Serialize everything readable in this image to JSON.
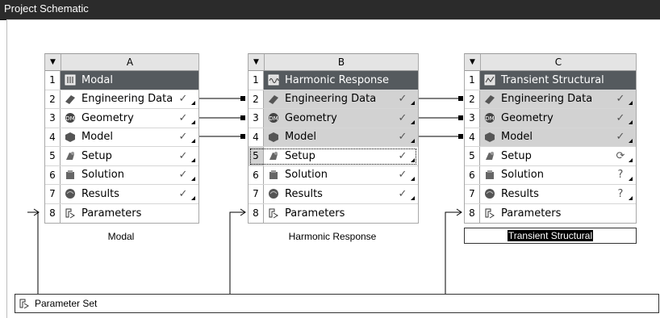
{
  "panel": {
    "title": "Project Schematic"
  },
  "systems": [
    {
      "letter": "A",
      "caption": "Modal",
      "rows": [
        {
          "num": "1",
          "label": "Modal",
          "status": "",
          "icon": "modal-icon"
        },
        {
          "num": "2",
          "label": "Engineering Data",
          "status": "✓",
          "icon": "engineering-data-icon"
        },
        {
          "num": "3",
          "label": "Geometry",
          "status": "✓",
          "icon": "geometry-icon"
        },
        {
          "num": "4",
          "label": "Model",
          "status": "✓",
          "icon": "model-icon"
        },
        {
          "num": "5",
          "label": "Setup",
          "status": "✓",
          "icon": "setup-icon"
        },
        {
          "num": "6",
          "label": "Solution",
          "status": "✓",
          "icon": "solution-icon"
        },
        {
          "num": "7",
          "label": "Results",
          "status": "✓",
          "icon": "results-icon"
        },
        {
          "num": "8",
          "label": "Parameters",
          "status": "",
          "icon": "parameters-icon"
        }
      ]
    },
    {
      "letter": "B",
      "caption": "Harmonic Response",
      "rows": [
        {
          "num": "1",
          "label": "Harmonic Response",
          "status": "",
          "icon": "harmonic-response-icon"
        },
        {
          "num": "2",
          "label": "Engineering Data",
          "status": "✓",
          "icon": "engineering-data-icon"
        },
        {
          "num": "3",
          "label": "Geometry",
          "status": "✓",
          "icon": "geometry-icon"
        },
        {
          "num": "4",
          "label": "Model",
          "status": "✓",
          "icon": "model-icon"
        },
        {
          "num": "5",
          "label": "Setup",
          "status": "✓",
          "icon": "setup-icon"
        },
        {
          "num": "6",
          "label": "Solution",
          "status": "✓",
          "icon": "solution-icon"
        },
        {
          "num": "7",
          "label": "Results",
          "status": "✓",
          "icon": "results-icon"
        },
        {
          "num": "8",
          "label": "Parameters",
          "status": "",
          "icon": "parameters-icon"
        }
      ]
    },
    {
      "letter": "C",
      "caption": "Transient Structural",
      "rows": [
        {
          "num": "1",
          "label": "Transient Structural",
          "status": "",
          "icon": "transient-structural-icon"
        },
        {
          "num": "2",
          "label": "Engineering Data",
          "status": "✓",
          "icon": "engineering-data-icon"
        },
        {
          "num": "3",
          "label": "Geometry",
          "status": "✓",
          "icon": "geometry-icon"
        },
        {
          "num": "4",
          "label": "Model",
          "status": "✓",
          "icon": "model-icon"
        },
        {
          "num": "5",
          "label": "Setup",
          "status": "⟳",
          "icon": "setup-icon"
        },
        {
          "num": "6",
          "label": "Solution",
          "status": "?",
          "icon": "solution-icon"
        },
        {
          "num": "7",
          "label": "Results",
          "status": "?",
          "icon": "results-icon"
        },
        {
          "num": "8",
          "label": "Parameters",
          "status": "",
          "icon": "parameters-icon"
        }
      ]
    }
  ],
  "parameter_set": {
    "label": "Parameter Set",
    "icon": "parameters-icon"
  }
}
